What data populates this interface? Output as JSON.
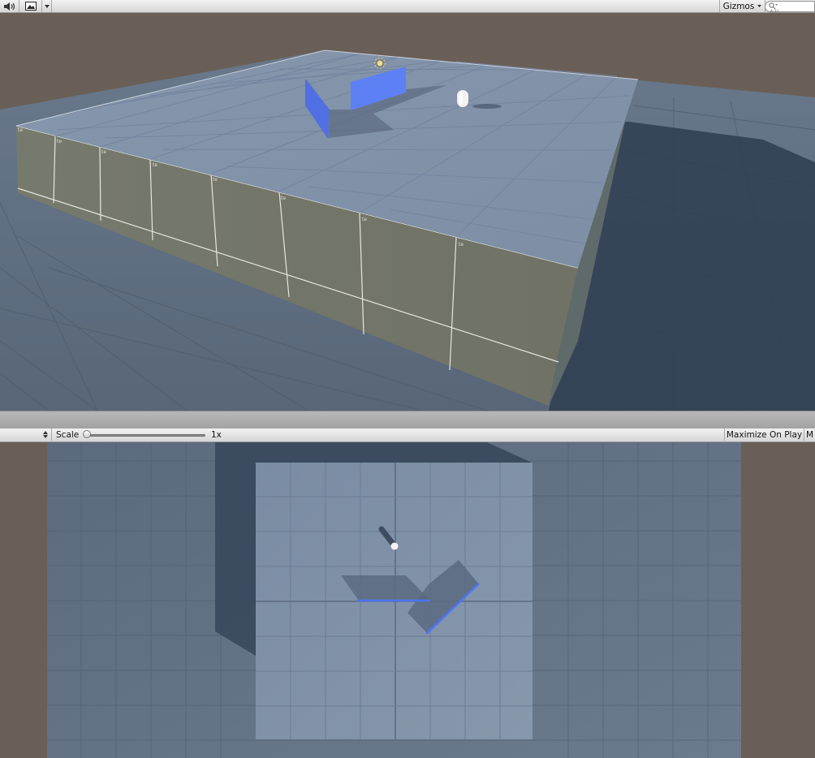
{
  "scene_toolbar": {
    "audio_icon": "speaker-icon",
    "image_effects_icon": "image-icon",
    "dropdown_icon": "chevron-down-icon",
    "gizmos_label": "Gizmos",
    "gizmos_dropdown_icon": "chevron-down-icon",
    "search_icon": "search-icon",
    "search_value": "All"
  },
  "game_toolbar": {
    "display_stepper_icon": "up-down-arrows-icon",
    "scale_label": "Scale",
    "scale_value": "1x",
    "scale_level": 0,
    "maximize_label": "Maximize On Play",
    "next_button_label": "M"
  },
  "scene": {
    "colors": {
      "ground": "#5f6e82",
      "platform_top": "#8394aa",
      "platform_side": "#727568",
      "wall_blue": "#5b7cf0",
      "shadow": "#2c3a4e",
      "background": "#6a5f56"
    },
    "objects": [
      "light-gizmo",
      "player-capsule",
      "blue-wall-left",
      "blue-wall-right"
    ]
  },
  "game": {
    "colors": {
      "ground": "#5a6a80",
      "platform": "#7e90a8",
      "wall_blue": "#4d74ff",
      "shadow": "#3a4a5e"
    }
  }
}
